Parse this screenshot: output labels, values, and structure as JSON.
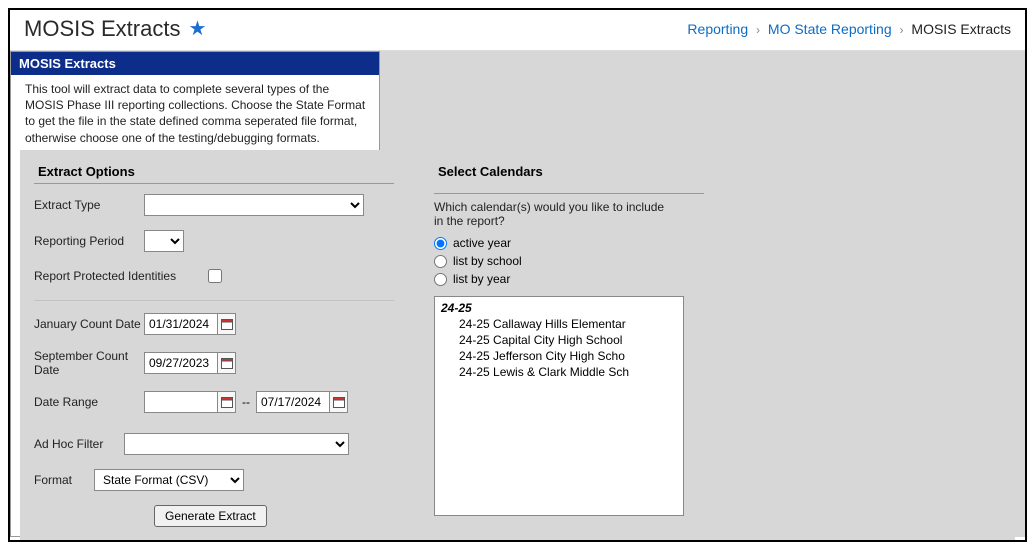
{
  "header": {
    "title": "MOSIS Extracts",
    "breadcrumb": {
      "items": [
        "Reporting",
        "MO State Reporting",
        "MOSIS Extracts"
      ]
    }
  },
  "panel": {
    "title": "MOSIS Extracts",
    "description": "This tool will extract data to complete several types of the MOSIS Phase III reporting collections. Choose the State Format to get the file in the state defined comma seperated file format, otherwise choose one of the testing/debugging formats."
  },
  "extract": {
    "section_title": "Extract Options",
    "labels": {
      "extract_type": "Extract Type",
      "reporting_period": "Reporting Period",
      "protected": "Report Protected Identities",
      "jan_count": "January Count Date",
      "sep_count": "September Count Date",
      "date_range": "Date Range",
      "adhoc": "Ad Hoc Filter",
      "format": "Format"
    },
    "values": {
      "extract_type": "",
      "reporting_period": "",
      "protected_checked": false,
      "jan_count": "01/31/2024",
      "sep_count": "09/27/2023",
      "range_start": "",
      "range_end": "07/17/2024",
      "adhoc": "",
      "format": "State Format (CSV)"
    },
    "generate_label": "Generate Extract"
  },
  "calendars": {
    "section_title": "Select Calendars",
    "prompt": "Which calendar(s) would you like to include in the report?",
    "mode_options": {
      "active": "active year",
      "school": "list by school",
      "year": "list by year"
    },
    "selected_mode": "active",
    "year_header": "24-25",
    "items": [
      "24-25 Callaway Hills Elementar",
      "24-25 Capital City High School",
      "24-25 Jefferson City High Scho",
      "24-25 Lewis & Clark Middle Sch"
    ]
  }
}
